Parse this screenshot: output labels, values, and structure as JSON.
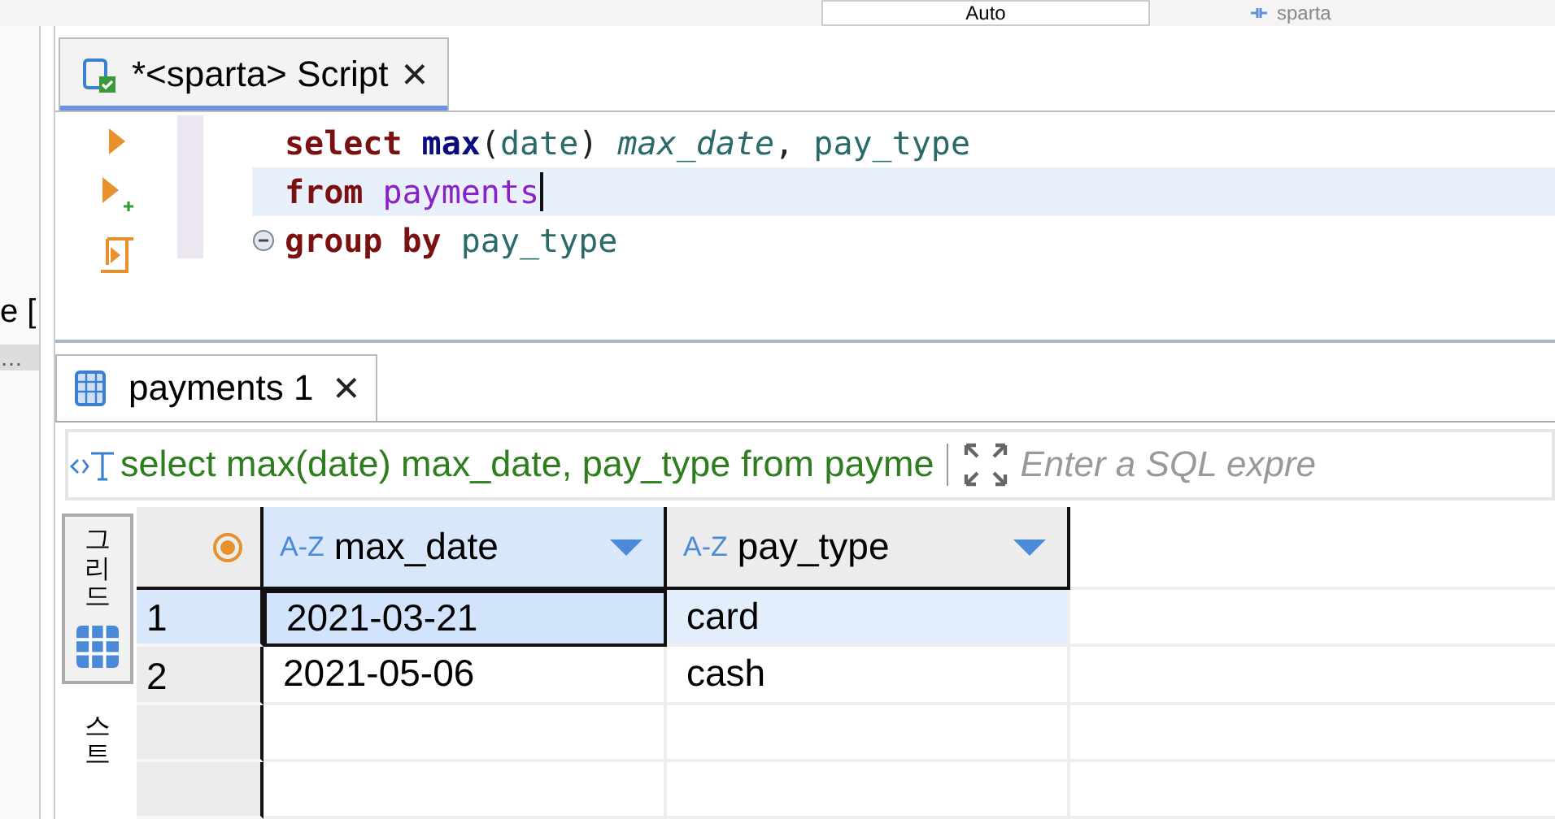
{
  "toolbar": {
    "items": [
      {
        "kind": "dropdown",
        "label": "Auto"
      },
      {
        "kind": "connection",
        "label": "sparta"
      }
    ]
  },
  "sidebar": {
    "items": [
      "e [",
      "…"
    ]
  },
  "editor_tab": {
    "title": "*<sparta> Script",
    "close": "×",
    "selected": true
  },
  "editor": {
    "lines": [
      {
        "current": false,
        "collapsible": false,
        "tokens": [
          {
            "kind": "keyword",
            "text": "select "
          },
          {
            "kind": "function",
            "text": "max"
          },
          {
            "kind": "plain",
            "text": "("
          },
          {
            "kind": "column",
            "text": "date"
          },
          {
            "kind": "plain",
            "text": ") "
          },
          {
            "kind": "alias",
            "text": "max_date"
          },
          {
            "kind": "plain",
            "text": ", "
          },
          {
            "kind": "column",
            "text": "pay_type"
          }
        ]
      },
      {
        "current": true,
        "collapsible": false,
        "tokens": [
          {
            "kind": "keyword",
            "text": "from "
          },
          {
            "kind": "table",
            "text": "payments"
          }
        ]
      },
      {
        "current": false,
        "collapsible": true,
        "tokens": [
          {
            "kind": "keyword",
            "text": "group by "
          },
          {
            "kind": "column",
            "text": "pay_type"
          }
        ]
      }
    ]
  },
  "results_tab": {
    "title": "payments 1",
    "close": "×",
    "selected": true
  },
  "filter": {
    "query": "select max(date) max_date, pay_type from payme",
    "placeholder": "Enter a SQL expre"
  },
  "side_tabs": [
    {
      "label": "그리드",
      "selected": true
    },
    {
      "label": "스트",
      "selected": false
    }
  ],
  "table": {
    "columns": [
      {
        "type": "A-Z",
        "name": "max_date",
        "selected": true
      },
      {
        "type": "A-Z",
        "name": "pay_type",
        "selected": false
      }
    ],
    "rows": [
      {
        "number": "1",
        "cells": [
          "2021-03-21",
          "card"
        ],
        "selected": true
      },
      {
        "number": "2",
        "cells": [
          "2021-05-06",
          "cash"
        ],
        "selected": false
      }
    ]
  }
}
